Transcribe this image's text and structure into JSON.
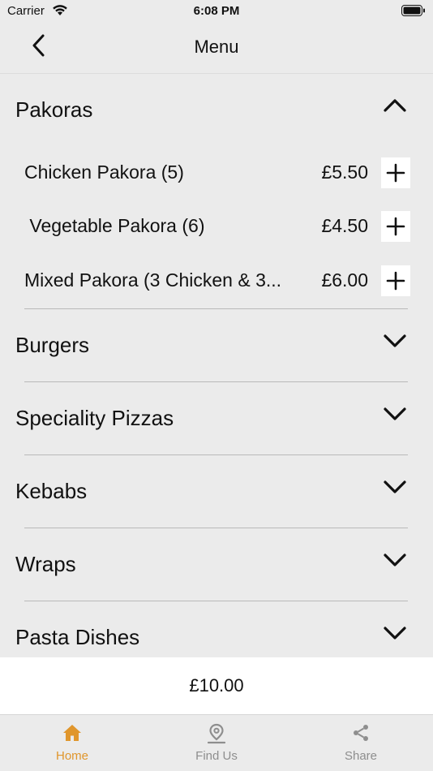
{
  "status_bar": {
    "carrier": "Carrier",
    "time": "6:08 PM"
  },
  "nav": {
    "title": "Menu"
  },
  "categories": [
    {
      "title": "Pakoras",
      "expanded": true
    },
    {
      "title": "Burgers",
      "expanded": false
    },
    {
      "title": "Speciality Pizzas",
      "expanded": false
    },
    {
      "title": "Kebabs",
      "expanded": false
    },
    {
      "title": "Wraps",
      "expanded": false
    },
    {
      "title": "Pasta Dishes",
      "expanded": false
    }
  ],
  "pakoras_items": [
    {
      "name": "Chicken Pakora (5)",
      "price": "£5.50"
    },
    {
      "name": " Vegetable Pakora (6)",
      "price": "£4.50"
    },
    {
      "name": "Mixed Pakora (3 Chicken & 3...",
      "price": "£6.00"
    }
  ],
  "basket": {
    "total": "£10.00"
  },
  "tabs": [
    {
      "label": "Home",
      "icon": "home-icon",
      "active": true
    },
    {
      "label": "Find Us",
      "icon": "map-pin-icon",
      "active": false
    },
    {
      "label": "Share",
      "icon": "share-icon",
      "active": false
    }
  ],
  "colors": {
    "accent": "#e0962c",
    "background": "#ebebeb",
    "inactive_tab": "#8e8e8e"
  }
}
